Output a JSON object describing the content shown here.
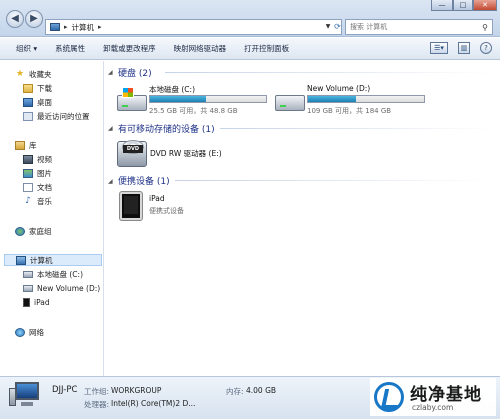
{
  "address_bar": {
    "breadcrumb": "计算机",
    "search_placeholder": "搜索 计算机"
  },
  "window_controls": {
    "minimize": "—",
    "maximize": "□",
    "close": "✕"
  },
  "toolbar": {
    "organize": "组织 ▾",
    "system_properties": "系统属性",
    "uninstall": "卸载或更改程序",
    "map_drive": "映射网络驱动器",
    "control_panel": "打开控制面板"
  },
  "nav": {
    "favorites": "收藏夹",
    "downloads": "下载",
    "desktop": "桌面",
    "recent": "最近访问的位置",
    "libraries": "库",
    "videos": "视频",
    "pictures": "图片",
    "documents": "文档",
    "music": "音乐",
    "homegroup": "家庭组",
    "computer": "计算机",
    "local_disk": "本地磁盘 (C:)",
    "new_volume": "New Volume (D:)",
    "ipad": "iPad",
    "network": "网络"
  },
  "main": {
    "hdd_group": "硬盘 (2)",
    "drives": [
      {
        "name": "本地磁盘 (C:)",
        "space": "25.5 GB 可用，共 48.8 GB",
        "used_fraction": 0.48
      },
      {
        "name": "New Volume (D:)",
        "space": "109 GB 可用，共 184 GB",
        "used_fraction": 0.41
      }
    ],
    "removable_group": "有可移动存储的设备 (1)",
    "dvd_name": "DVD RW 驱动器 (E:)",
    "dvd_badge": "DVD",
    "portable_group": "便携设备 (1)",
    "ipad_name": "iPad",
    "ipad_type": "便携式设备"
  },
  "details": {
    "pc_name": "DJJ-PC",
    "workgroup_label": "工作组:",
    "workgroup_value": "WORKGROUP",
    "memory_label": "内存:",
    "memory_value": "4.00 GB",
    "cpu_label": "处理器:",
    "cpu_value": "Intel(R) Core(TM)2 D..."
  },
  "watermark": {
    "title": "纯净基地",
    "url": "czlaby.com"
  }
}
